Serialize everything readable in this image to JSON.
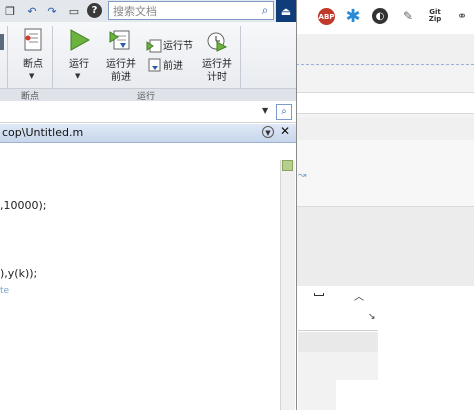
{
  "matlab": {
    "search_placeholder": "搜索文档",
    "ribbon": {
      "breakpoints_label": "断点",
      "run_label": "运行",
      "run_advance_label": "运行并\n前进",
      "run_section_label": "运行节",
      "advance_label": "前进",
      "run_time_label": "运行并\n计时",
      "group_breakpoints": "断点",
      "group_run": "运行"
    },
    "editor": {
      "tab_title": "cop\\Untitled.m",
      "code_lines": [
        ",10000);",
        "),y(k));",
        "te"
      ]
    }
  },
  "browser": {
    "extensions": [
      "ABP",
      "Git Zip"
    ]
  },
  "colors": {
    "accent_blue": "#0f3d7a",
    "tab_blue": "#c7d7ec",
    "abp_red": "#c0392b"
  }
}
